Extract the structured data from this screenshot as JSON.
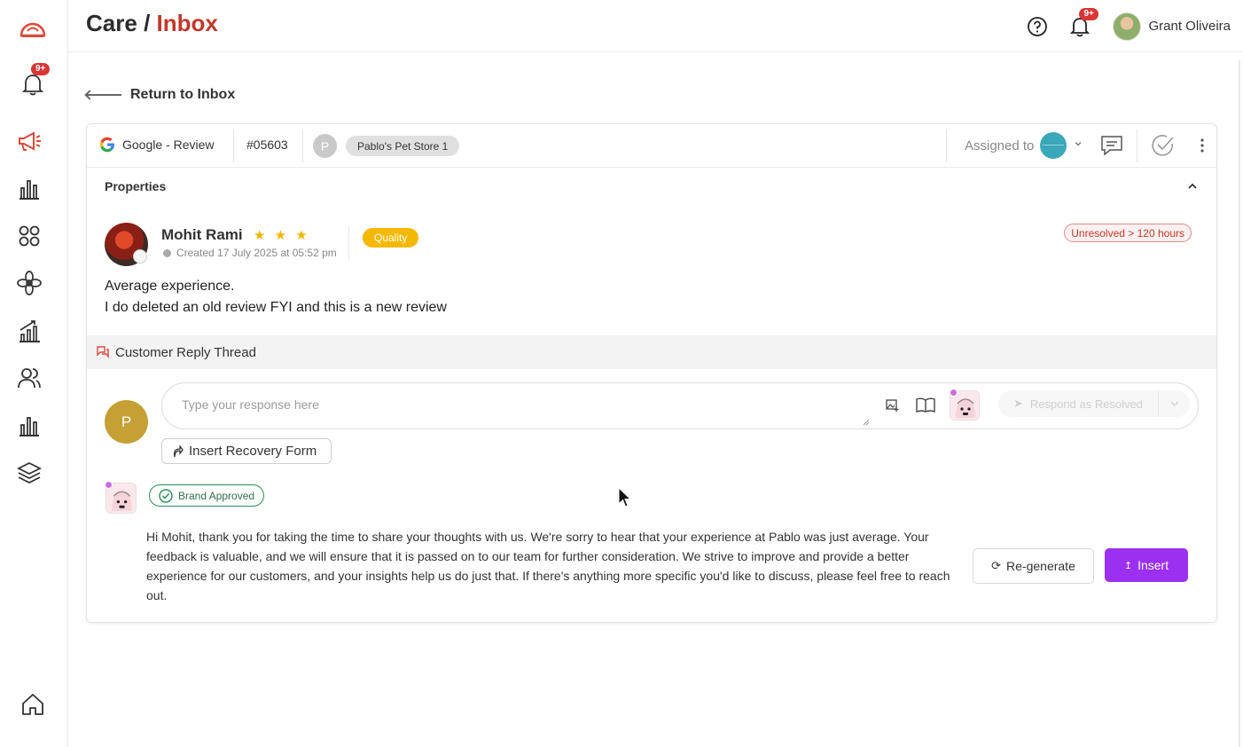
{
  "header": {
    "title_main": "Care",
    "title_sep": "/",
    "title_crumb": "Inbox",
    "notif_badge": "9+",
    "user_name": "Grant Oliveira"
  },
  "sidebar": {
    "notif_badge": "9+",
    "items": [
      "logo-icon",
      "bell-icon",
      "megaphone-icon",
      "bar-chart-icon",
      "apps-grid-icon",
      "flower-icon",
      "growth-chart-icon",
      "users-icon",
      "bar-chart-icon",
      "layers-icon",
      "home-icon"
    ]
  },
  "nav": {
    "return_label": "Return to Inbox"
  },
  "ticket": {
    "source": "Google - Review",
    "id": "#05603",
    "store_initial": "P",
    "store_name": "Pablo's Pet Store 1",
    "assigned_label": "Assigned to"
  },
  "properties": {
    "title": "Properties"
  },
  "review": {
    "author": "Mohit Rami",
    "stars": "★ ★ ★",
    "rating": 3,
    "created": "Created 17 July 2025 at 05:52 pm",
    "tag": "Quality",
    "status": "Unresolved > 120 hours",
    "line1": "Average experience.",
    "line2": "I do deleted an old review FYI and this is a new review"
  },
  "thread": {
    "title": "Customer Reply Thread"
  },
  "reply": {
    "avatar_initial": "P",
    "placeholder": "Type your response here",
    "respond_label": "Respond as Resolved",
    "recovery_label": "Insert Recovery Form"
  },
  "suggestion": {
    "badge": "Brand Approved",
    "text": "Hi Mohit, thank you for taking the time to share your thoughts with us. We're sorry to hear that your experience at Pablo was just average. Your feedback is valuable, and we will ensure that it is passed on to our team for further consideration. We strive to improve and provide a better experience for our customers, and your insights help us do just that. If there's anything more specific you'd like to discuss, please feel free to reach out.",
    "regenerate_label": "Re-generate",
    "insert_label": "Insert"
  },
  "colors": {
    "accent_red": "#c0392b",
    "insert_purple": "#9b30f0",
    "quality_yellow": "#f5b800",
    "approved_green": "#2e8b57"
  }
}
